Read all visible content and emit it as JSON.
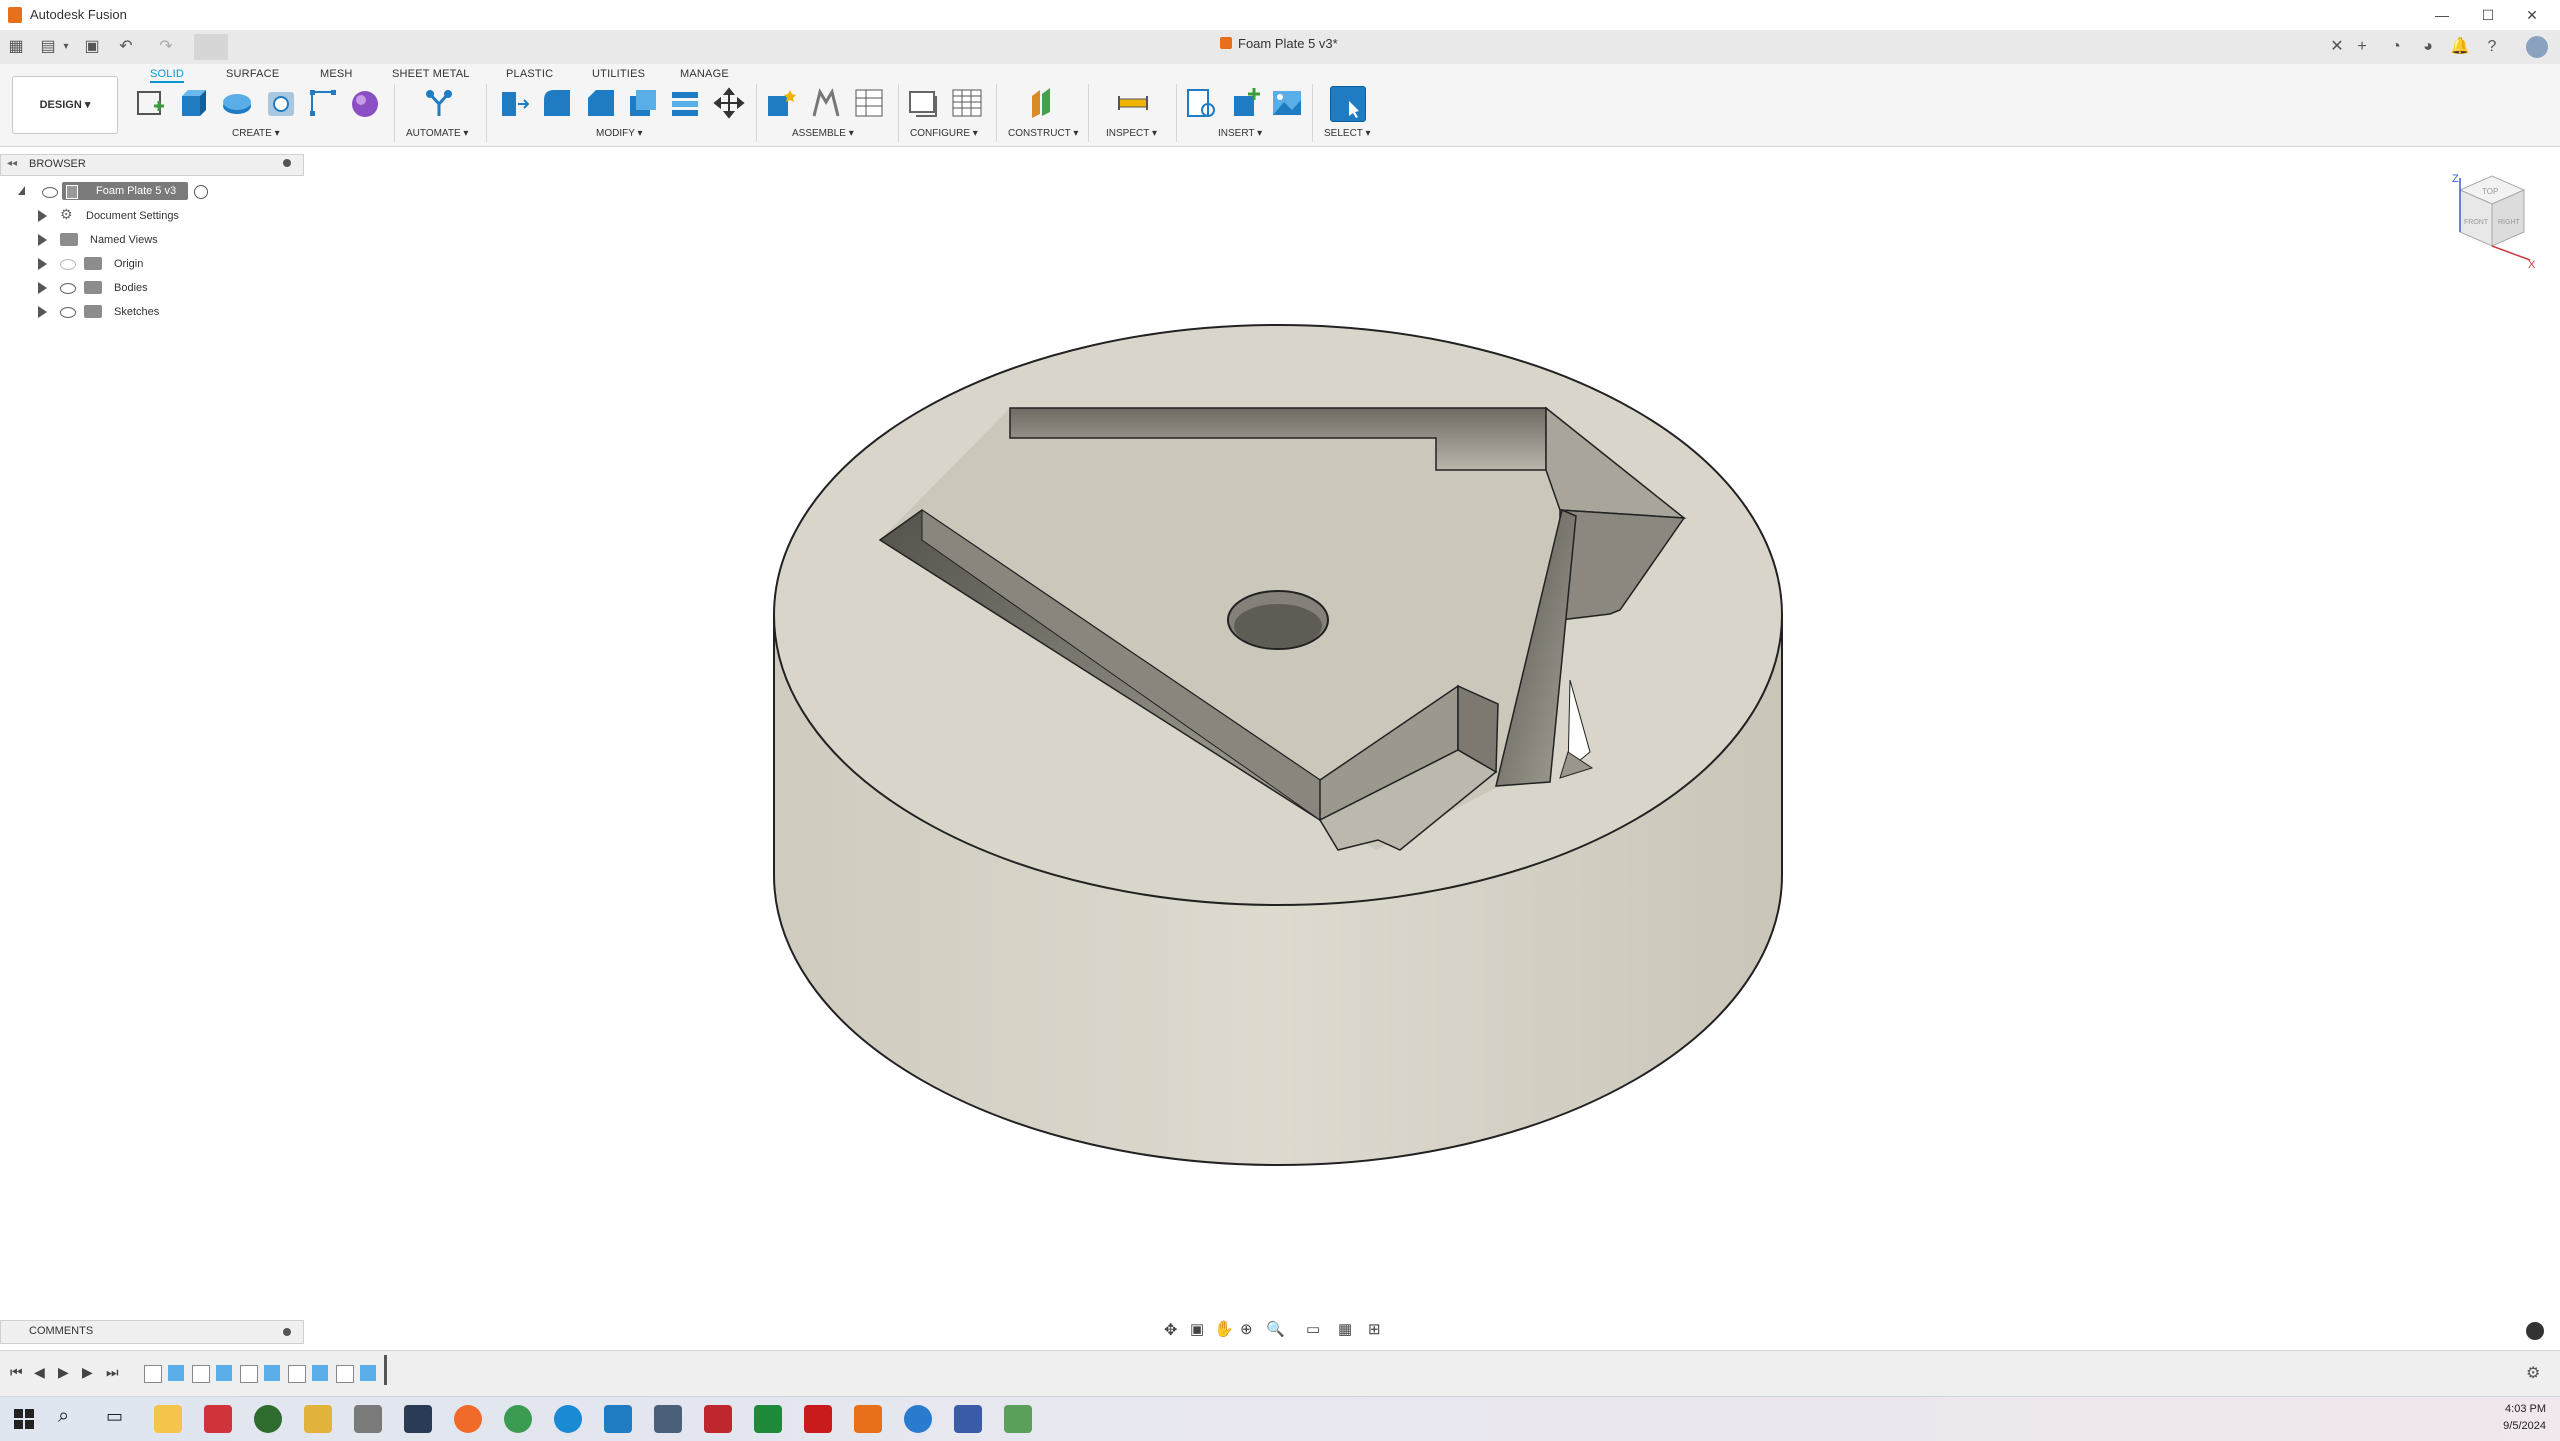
{
  "window": {
    "title": "Autodesk Fusion",
    "document_title": "Foam Plate 5 v3*"
  },
  "workspace": {
    "label": "DESIGN ▾"
  },
  "ribbon": {
    "tabs": [
      {
        "label": "SOLID",
        "active": true
      },
      {
        "label": "SURFACE",
        "active": false
      },
      {
        "label": "MESH",
        "active": false
      },
      {
        "label": "SHEET METAL",
        "active": false
      },
      {
        "label": "PLASTIC",
        "active": false
      },
      {
        "label": "UTILITIES",
        "active": false
      },
      {
        "label": "MANAGE",
        "active": false
      }
    ],
    "groups": {
      "create": "CREATE ▾",
      "automate": "AUTOMATE ▾",
      "modify": "MODIFY ▾",
      "assemble": "ASSEMBLE ▾",
      "configure": "CONFIGURE ▾",
      "construct": "CONSTRUCT ▾",
      "inspect": "INSPECT ▾",
      "insert": "INSERT ▾",
      "select": "SELECT ▾"
    }
  },
  "browser": {
    "header": "BROWSER",
    "root": "Foam Plate 5 v3",
    "items": [
      {
        "label": "Document Settings",
        "icon": "gear-icon"
      },
      {
        "label": "Named Views",
        "icon": "folder-icon"
      },
      {
        "label": "Origin",
        "icon": "folder-icon"
      },
      {
        "label": "Bodies",
        "icon": "folder-icon"
      },
      {
        "label": "Sketches",
        "icon": "folder-icon"
      }
    ]
  },
  "comments": {
    "label": "COMMENTS"
  },
  "viewcube": {
    "top": "TOP",
    "front": "FRONT",
    "right": "RIGHT",
    "axis_z": "Z",
    "axis_x": "X"
  },
  "clock": {
    "time": "4:03 PM",
    "date": "9/5/2024"
  },
  "colors": {
    "accent": "#0696d7",
    "brand": "#e8701a",
    "foam": "#d8d4c9"
  }
}
